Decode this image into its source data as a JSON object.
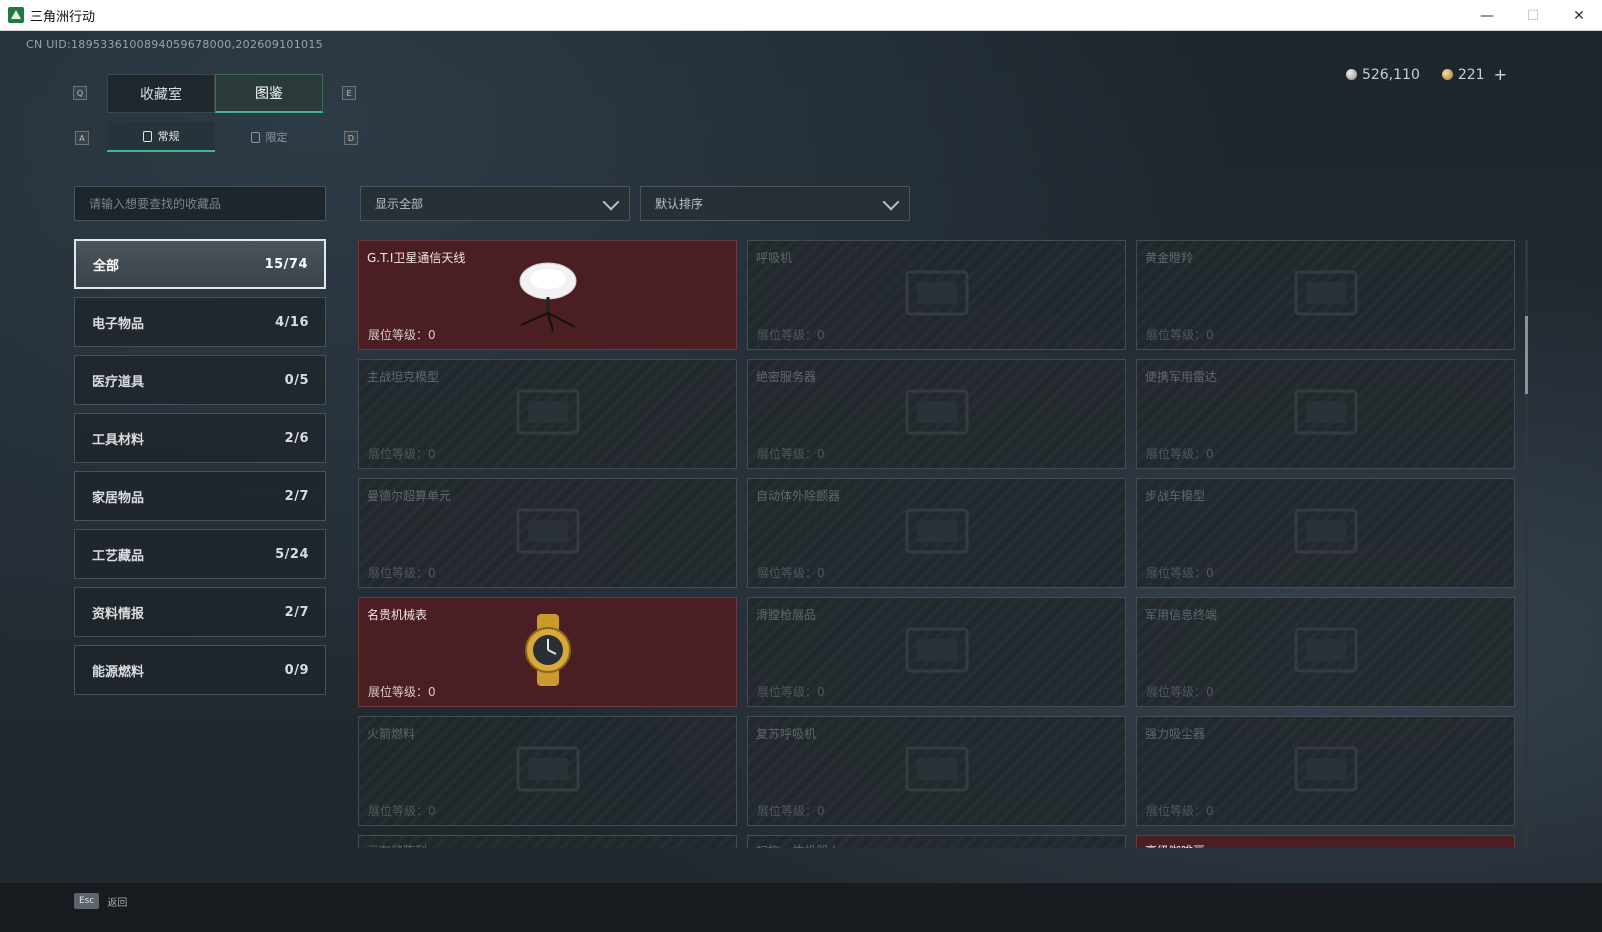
{
  "window": {
    "title": "三角洲行动"
  },
  "uid": "CN UID:1895336100894059678000,202609101015",
  "currency": {
    "silver": "526,110",
    "gold": "221",
    "plus": "+"
  },
  "keys": {
    "prev_tab": "Q",
    "next_tab": "E",
    "prev_sub": "A",
    "next_sub": "D"
  },
  "tabs": [
    {
      "label": "收藏室",
      "active": false
    },
    {
      "label": "图鉴",
      "active": true
    }
  ],
  "subtabs": [
    {
      "label": "常规",
      "active": true
    },
    {
      "label": "限定",
      "active": false
    }
  ],
  "search": {
    "placeholder": "请输入想要查找的收藏品"
  },
  "filters": {
    "show": "显示全部",
    "sort": "默认排序"
  },
  "categories": [
    {
      "label": "全部",
      "count": "15/74",
      "active": true
    },
    {
      "label": "电子物品",
      "count": "4/16"
    },
    {
      "label": "医疗道具",
      "count": "0/5"
    },
    {
      "label": "工具材料",
      "count": "2/6"
    },
    {
      "label": "家居物品",
      "count": "2/7"
    },
    {
      "label": "工艺藏品",
      "count": "5/24"
    },
    {
      "label": "资料情报",
      "count": "2/7"
    },
    {
      "label": "能源燃料",
      "count": "0/9"
    }
  ],
  "level_label": "展位等级：",
  "items": [
    {
      "name": "G.T.I卫星通信天线",
      "level": "0",
      "owned": true,
      "icon": "satellite-dish-icon"
    },
    {
      "name": "呼吸机",
      "level": "0",
      "owned": false,
      "icon": "ventilator-icon"
    },
    {
      "name": "黄金瞪羚",
      "level": "0",
      "owned": false,
      "icon": "gazelle-statue-icon"
    },
    {
      "name": "主战坦克模型",
      "level": "0",
      "owned": false,
      "icon": "tank-model-icon"
    },
    {
      "name": "绝密服务器",
      "level": "0",
      "owned": false,
      "icon": "server-icon"
    },
    {
      "name": "便携军用雷达",
      "level": "0",
      "owned": false,
      "icon": "radar-icon"
    },
    {
      "name": "曼德尔超算单元",
      "level": "0",
      "owned": false,
      "icon": "compute-unit-icon"
    },
    {
      "name": "自动体外除颤器",
      "level": "0",
      "owned": false,
      "icon": "defibrillator-icon"
    },
    {
      "name": "步战车模型",
      "level": "0",
      "owned": false,
      "icon": "ifv-model-icon"
    },
    {
      "name": "名贵机械表",
      "level": "0",
      "owned": true,
      "icon": "watch-icon"
    },
    {
      "name": "滑膛枪展品",
      "level": "0",
      "owned": false,
      "icon": "musket-icon"
    },
    {
      "name": "军用信息终端",
      "level": "0",
      "owned": false,
      "icon": "terminal-icon"
    },
    {
      "name": "火箭燃料",
      "level": "0",
      "owned": false,
      "icon": "fuel-icon"
    },
    {
      "name": "复苏呼吸机",
      "level": "0",
      "owned": false,
      "icon": "resuscitator-icon"
    },
    {
      "name": "强力吸尘器",
      "level": "0",
      "owned": false,
      "icon": "vacuum-icon"
    }
  ],
  "partial_row": [
    {
      "name": "云存储阵列",
      "owned": false
    },
    {
      "name": "扫拖一体机器人",
      "owned": false
    },
    {
      "name": "高级咖啡豆",
      "owned": true
    }
  ],
  "footer": {
    "esc_key": "Esc",
    "back": "返回"
  }
}
